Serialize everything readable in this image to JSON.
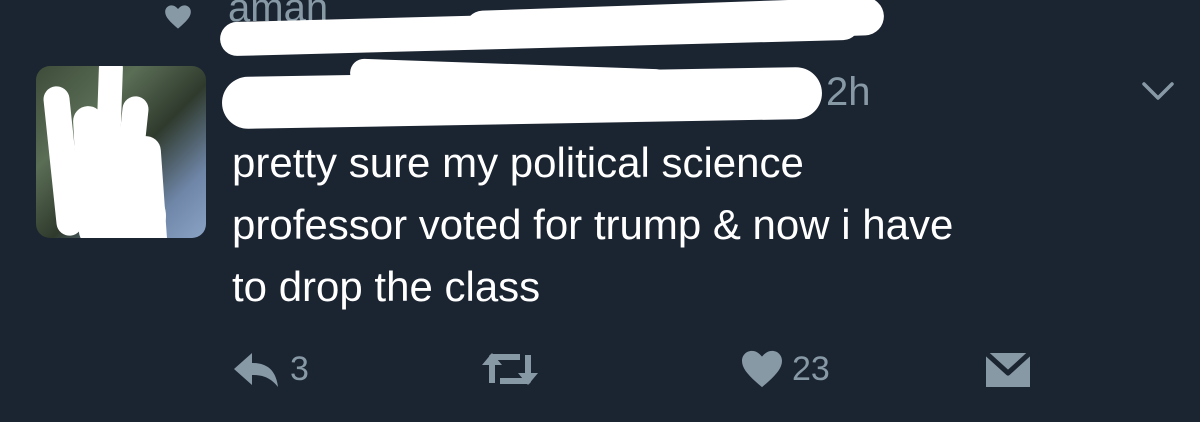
{
  "context": {
    "icon": "heart-icon",
    "text": "aman"
  },
  "tweet": {
    "timestamp": "2h",
    "text": "pretty sure my political science\nprofessor voted for trump & now i have\nto drop the class"
  },
  "actions": {
    "reply_count": "3",
    "retweet_count": "",
    "like_count": "23"
  },
  "colors": {
    "background": "#1b2431",
    "secondary_text": "#8899a6",
    "primary_text": "#ffffff"
  }
}
